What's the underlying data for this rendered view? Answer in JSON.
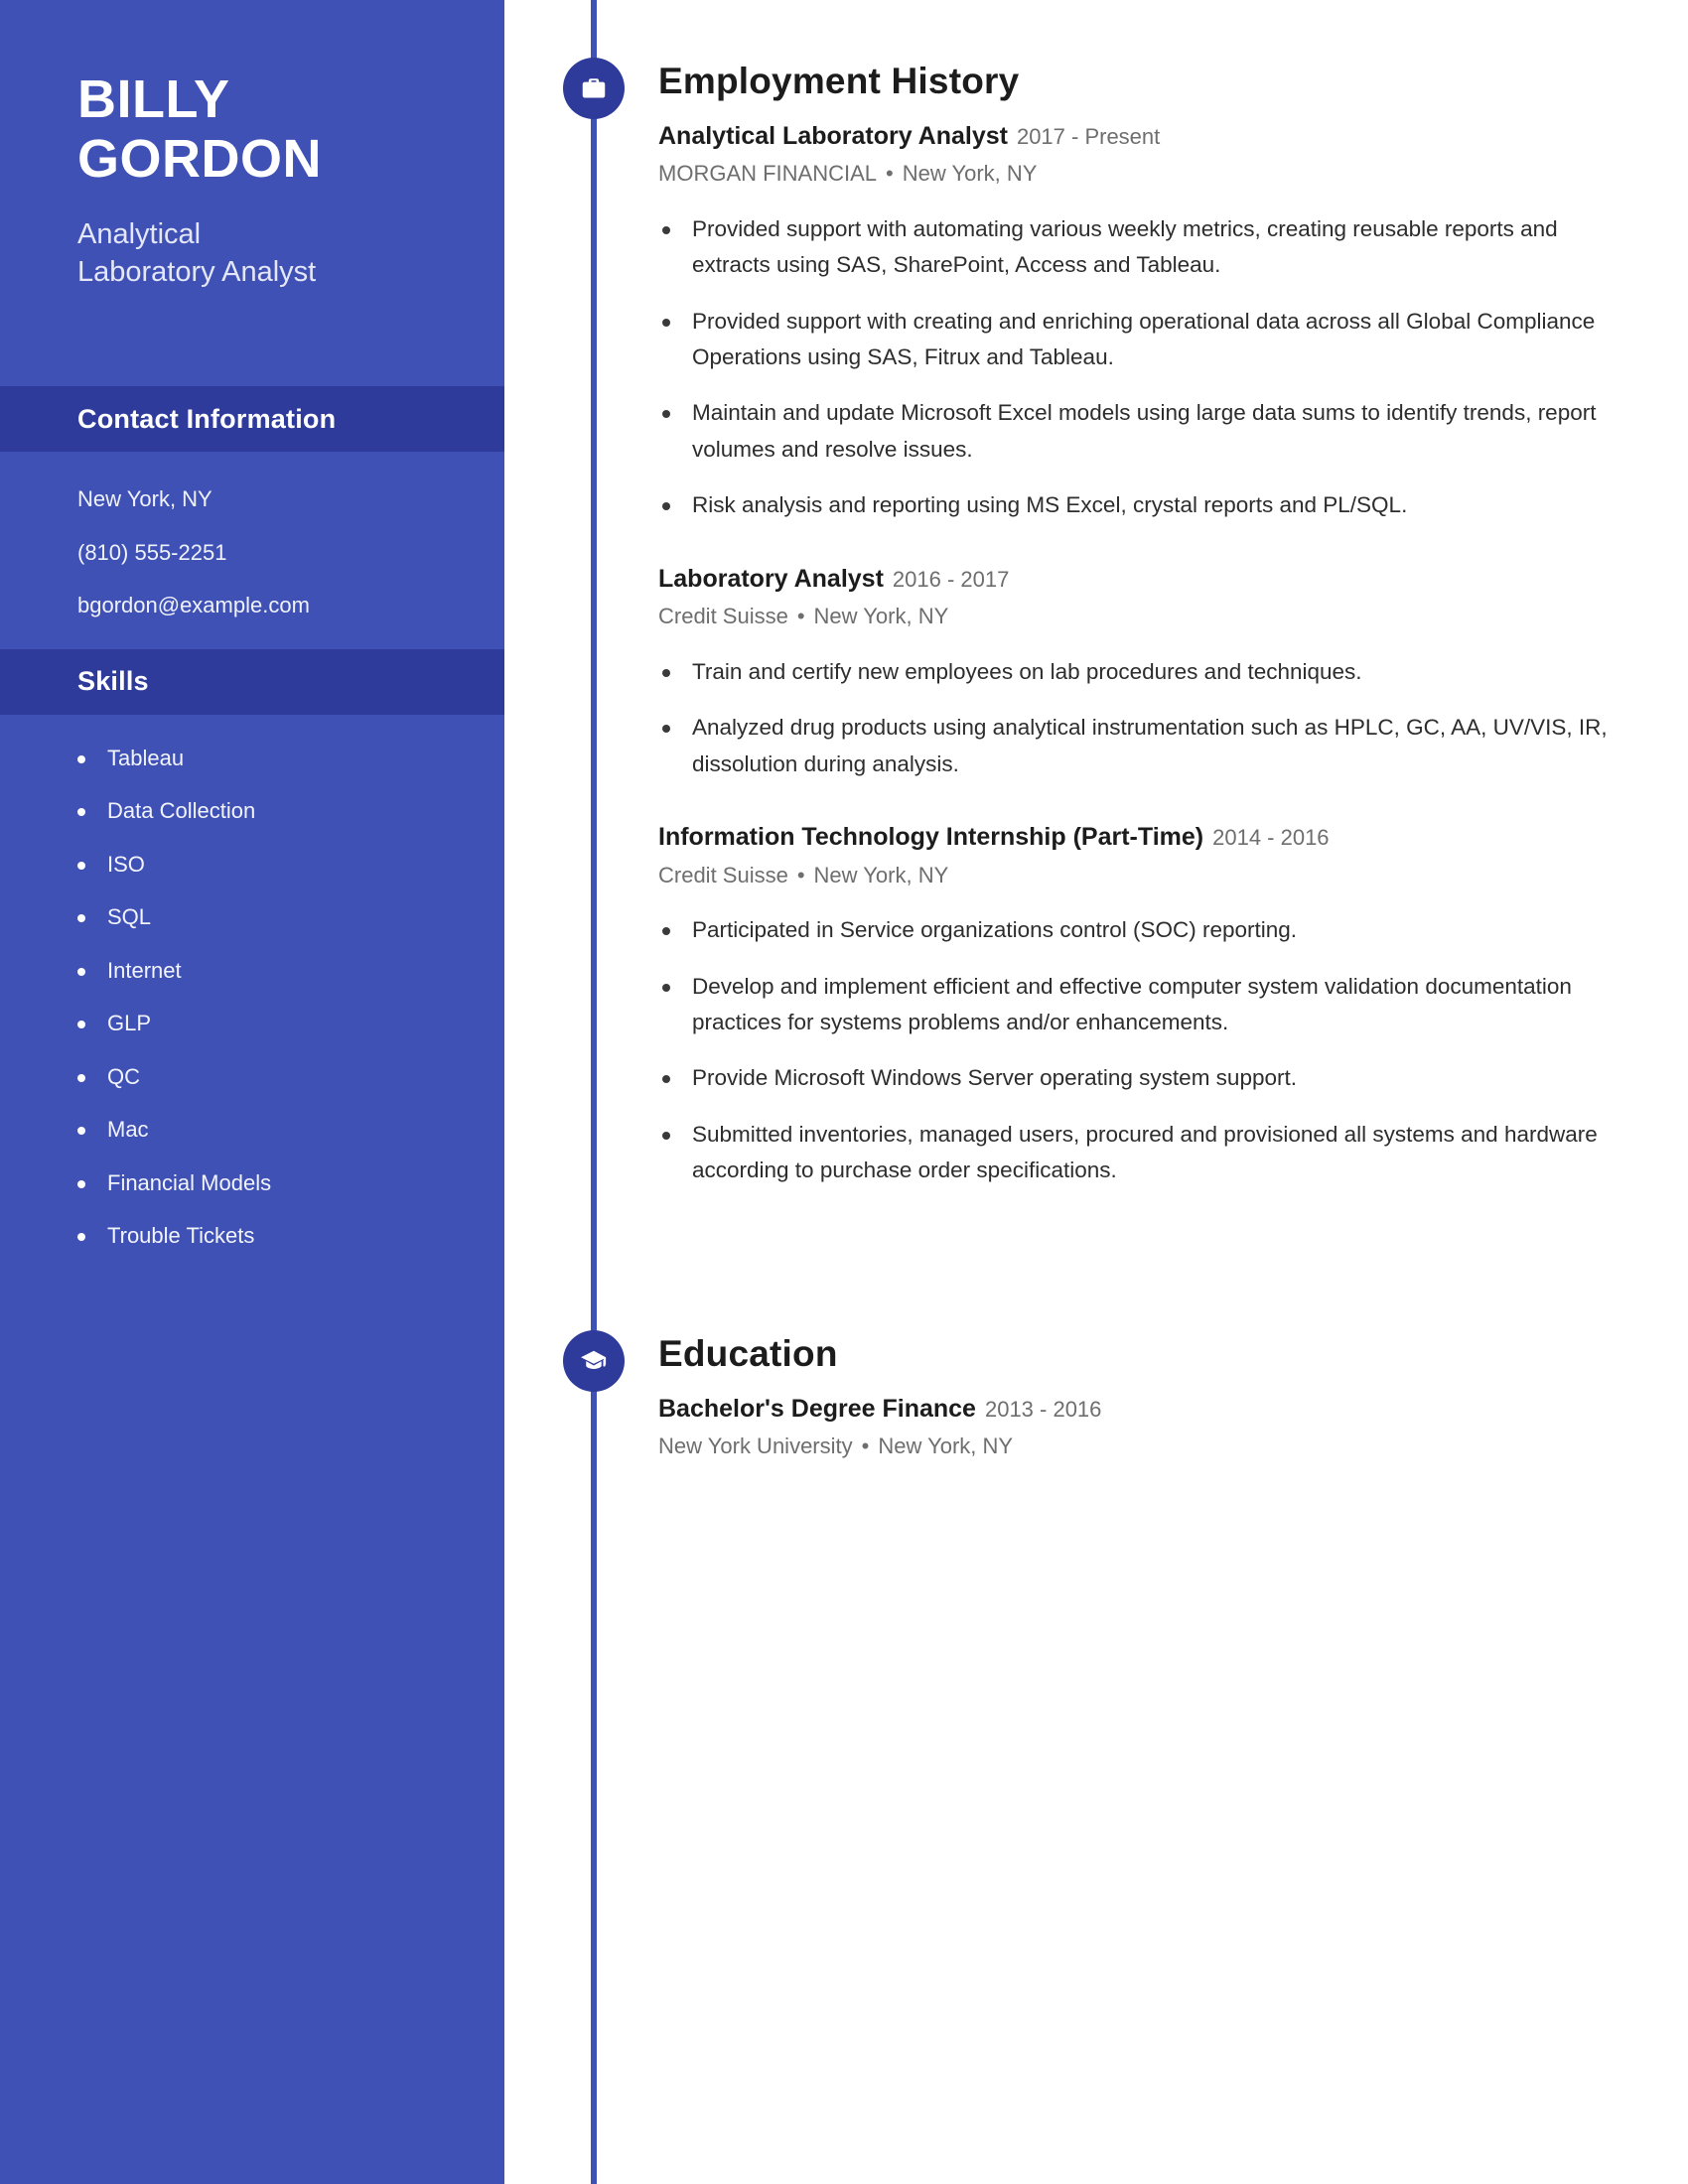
{
  "theme": {
    "sidebar_bg": "#3f51b5",
    "sidebar_header_bg": "#2e3b9b",
    "accent": "#2e3b9b",
    "text_dark": "#1c1c1c",
    "text_muted": "#6e6e6e"
  },
  "sidebar": {
    "first_name": "BILLY",
    "last_name": "GORDON",
    "job_title_line1": "Analytical",
    "job_title_line2": "Laboratory Analyst",
    "contact": {
      "heading": "Contact Information",
      "lines": [
        "New York, NY",
        "(810) 555-2251",
        "bgordon@example.com"
      ]
    },
    "skills": {
      "heading": "Skills",
      "items": [
        "Tableau",
        "Data Collection",
        "ISO",
        "SQL",
        "Internet",
        "GLP",
        "QC",
        "Mac",
        "Financial Models",
        "Trouble Tickets"
      ]
    }
  },
  "main": {
    "employment": {
      "heading": "Employment History",
      "icon": "briefcase-icon",
      "entries": [
        {
          "role": "Analytical Laboratory Analyst",
          "dates": "2017 - Present",
          "company": "MORGAN FINANCIAL",
          "location": "New York, NY",
          "bullets": [
            "Provided support with automating various weekly metrics, creating reusable reports and extracts using SAS, SharePoint, Access and Tableau.",
            "Provided support with creating and enriching operational data across all Global Compliance Operations using SAS, Fitrux and Tableau.",
            "Maintain and update Microsoft Excel models using large data sums to identify trends, report volumes and resolve issues.",
            "Risk analysis and reporting using MS Excel, crystal reports and PL/SQL."
          ]
        },
        {
          "role": "Laboratory Analyst",
          "dates": "2016 - 2017",
          "company": "Credit Suisse",
          "location": "New York, NY",
          "bullets": [
            "Train and certify new employees on lab procedures and techniques.",
            "Analyzed drug products using analytical instrumentation such as HPLC, GC, AA, UV/VIS, IR, dissolution during analysis."
          ]
        },
        {
          "role": "Information Technology Internship (Part-Time)",
          "dates": "2014 - 2016",
          "company": "Credit Suisse",
          "location": "New York, NY",
          "bullets": [
            "Participated in Service organizations control (SOC) reporting.",
            "Develop and implement efficient and effective computer system validation documentation practices for systems problems and/or enhancements.",
            "Provide Microsoft Windows Server operating system support.",
            "Submitted inventories, managed users, procured and provisioned all systems and hardware according to purchase order specifications."
          ]
        }
      ]
    },
    "education": {
      "heading": "Education",
      "icon": "graduation-cap-icon",
      "entries": [
        {
          "degree": "Bachelor's Degree Finance",
          "dates": "2013 - 2016",
          "school": "New York University",
          "location": "New York, NY"
        }
      ]
    },
    "separator": "•"
  }
}
